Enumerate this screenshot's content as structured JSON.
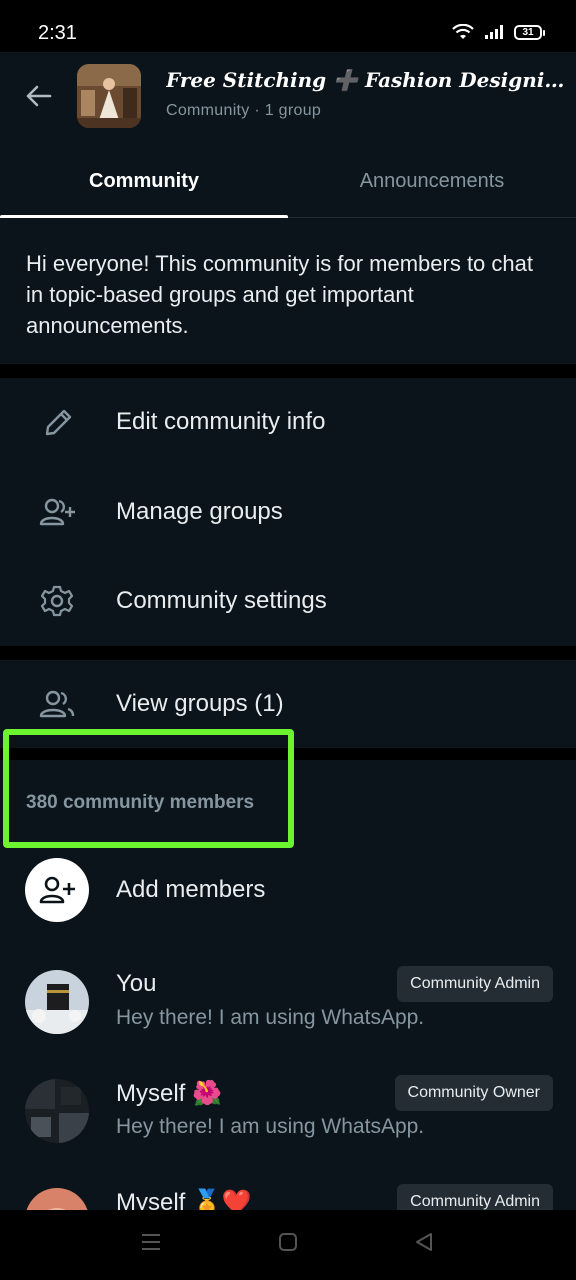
{
  "status_bar": {
    "time": "2:31",
    "battery": "31"
  },
  "header": {
    "title": "Free Stitching ➕ Fashion Designing A…",
    "subtitle": "Community · 1 group"
  },
  "tabs": [
    {
      "label": "Community",
      "active": true
    },
    {
      "label": "Announcements",
      "active": false
    }
  ],
  "description": "Hi everyone! This community is for members to chat in topic-based groups and get important announcements.",
  "menu": [
    {
      "label": "Edit community info",
      "icon": "pencil-icon"
    },
    {
      "label": "Manage groups",
      "icon": "group-add-icon"
    },
    {
      "label": "Community settings",
      "icon": "gear-icon"
    }
  ],
  "view_groups": {
    "label": "View groups (1)",
    "icon": "groups-icon"
  },
  "members_section": {
    "count_label": "380 community members",
    "add_label": "Add members",
    "members": [
      {
        "name": "You",
        "status": "Hey there! I am using WhatsApp.",
        "badge": "Community Admin"
      },
      {
        "name": "Myself 🌺",
        "status": "Hey there! I am using WhatsApp.",
        "badge": "Community Owner"
      },
      {
        "name": "Myself 🏅❤️",
        "status": "",
        "badge": "Community Admin"
      }
    ]
  },
  "colors": {
    "background": "#0b141a",
    "secondary_text": "#8696a0",
    "badge_bg": "#232d33",
    "highlight": "#6cf52f"
  }
}
